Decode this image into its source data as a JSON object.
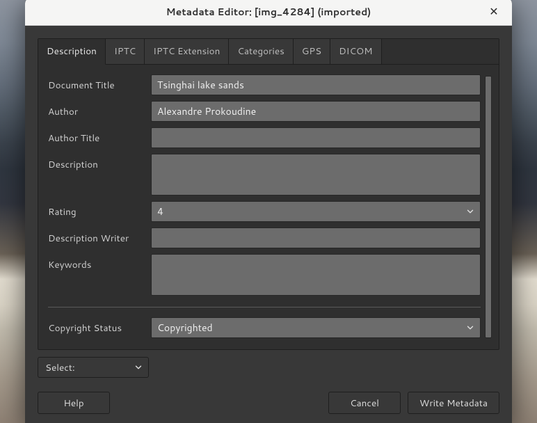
{
  "title": "Metadata Editor: [img_4284] (imported)",
  "tabs": [
    {
      "label": "Description"
    },
    {
      "label": "IPTC"
    },
    {
      "label": "IPTC Extension"
    },
    {
      "label": "Categories"
    },
    {
      "label": "GPS"
    },
    {
      "label": "DICOM"
    }
  ],
  "active_tab_index": 0,
  "fields": {
    "document_title": {
      "label": "Document Title",
      "value": "Tsinghai lake sands"
    },
    "author": {
      "label": "Author",
      "value": "Alexandre Prokoudine"
    },
    "author_title": {
      "label": "Author Title",
      "value": ""
    },
    "description": {
      "label": "Description",
      "value": ""
    },
    "rating": {
      "label": "Rating",
      "value": "4"
    },
    "desc_writer": {
      "label": "Description Writer",
      "value": ""
    },
    "keywords": {
      "label": "Keywords",
      "value": ""
    },
    "copyright": {
      "label": "Copyright Status",
      "value": "Copyrighted"
    }
  },
  "lower_select": {
    "value": "Select:"
  },
  "buttons": {
    "help": "Help",
    "cancel": "Cancel",
    "write": "Write Metadata"
  }
}
